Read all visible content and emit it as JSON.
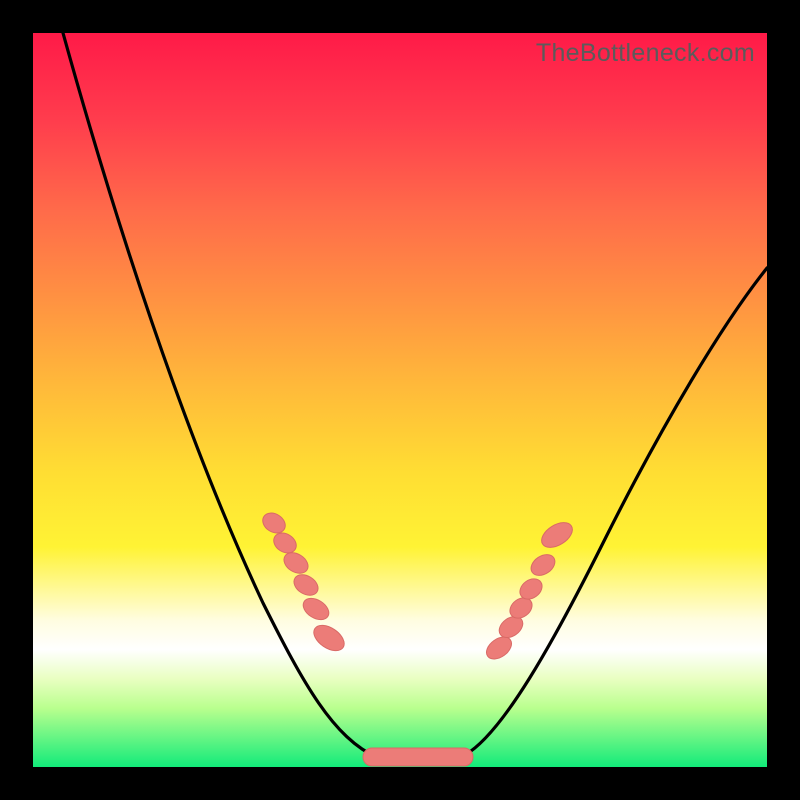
{
  "watermark": "TheBottleneck.com",
  "colors": {
    "page_bg": "#000000",
    "curve_stroke": "#000000",
    "marker_fill": "#ec7c78",
    "marker_stroke": "#d96a66"
  },
  "chart_data": {
    "type": "line",
    "title": "",
    "xlabel": "",
    "ylabel": "",
    "xlim": [
      0,
      100
    ],
    "ylim": [
      0,
      100
    ],
    "grid": false,
    "legend": false,
    "annotations": [
      "TheBottleneck.com"
    ],
    "series": [
      {
        "name": "bottleneck-curve",
        "x": [
          4,
          8,
          12,
          16,
          20,
          24,
          28,
          32,
          36,
          40,
          44,
          47,
          50,
          53,
          56,
          60,
          64,
          68,
          72,
          76,
          80,
          84,
          88,
          92,
          96,
          100
        ],
        "y": [
          100,
          92,
          84,
          76,
          68,
          60,
          52,
          44,
          36,
          28,
          20,
          12,
          5,
          1,
          1,
          4,
          10,
          17,
          24,
          31,
          38,
          44,
          50,
          56,
          62,
          68
        ]
      }
    ],
    "markers": {
      "name": "highlighted-points",
      "shape": "capsule",
      "groups": [
        {
          "x": [
            32,
            33.5,
            35,
            36.5,
            38,
            39.5
          ],
          "y": [
            33,
            30,
            27,
            23.5,
            20,
            15
          ]
        },
        {
          "x": [
            46,
            49,
            52,
            55,
            58
          ],
          "y": [
            1.5,
            1.2,
            1.2,
            1.2,
            1.8
          ]
        },
        {
          "x": [
            64,
            65.5,
            67,
            68,
            69.5,
            71
          ],
          "y": [
            15,
            18,
            21,
            24,
            28,
            33
          ]
        }
      ]
    }
  }
}
